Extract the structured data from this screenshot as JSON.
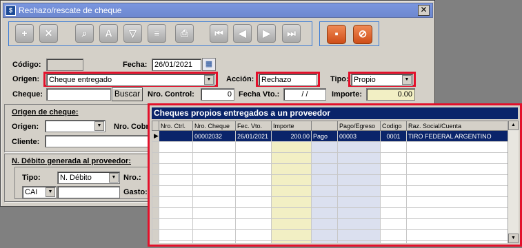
{
  "window": {
    "title": "Rechazo/rescate de cheque",
    "close_label": "✕"
  },
  "toolbar": {
    "buttons": [
      {
        "name": "add",
        "glyph": "+"
      },
      {
        "name": "delete",
        "glyph": "✕"
      },
      {
        "name": "search",
        "glyph": "⌕"
      },
      {
        "name": "sort",
        "glyph": "A"
      },
      {
        "name": "filter",
        "glyph": "▽"
      },
      {
        "name": "document",
        "glyph": "≡"
      },
      {
        "name": "print",
        "glyph": "⎙"
      },
      {
        "name": "first",
        "glyph": "⏮"
      },
      {
        "name": "prev",
        "glyph": "◀"
      },
      {
        "name": "next",
        "glyph": "▶"
      },
      {
        "name": "last",
        "glyph": "⏭"
      }
    ],
    "save_glyph": "▪",
    "cancel_glyph": "⊘"
  },
  "form": {
    "codigo_label": "Código:",
    "codigo_value": "",
    "fecha_label": "Fecha:",
    "fecha_value": "26/01/2021",
    "origen_label": "Origen:",
    "origen_value": "Cheque entregado",
    "accion_label": "Acción:",
    "accion_value": "Rechazo",
    "tipo_label": "Tipo:",
    "tipo_value": "Propio",
    "cheque_label": "Cheque:",
    "cheque_value": "",
    "buscar_label": "Buscar",
    "nro_control_label": "Nro. Control:",
    "nro_control_value": "0",
    "fecha_vto_label": "Fecha Vto.:",
    "fecha_vto_value": " / /",
    "importe_label": "Importe:",
    "importe_value": "0.00"
  },
  "origen_cheque": {
    "section_label": "Origen de cheque:",
    "origen_label": "Origen:",
    "origen_value": "",
    "nro_cobr_label": "Nro. Cobr",
    "cliente_label": "Cliente:",
    "cliente_value": ""
  },
  "debito": {
    "section_label": "N. Débito generada al proveedor:",
    "tipo_label": "Tipo:",
    "tipo_value": "N. Débito",
    "nro_label": "Nro.:",
    "cai_value": "CAI",
    "gasto_label": "Gasto:"
  },
  "grid": {
    "title": "Cheques propios entregados a un proveedor",
    "columns": [
      "",
      "Nro. Ctrl.",
      "Nro. Cheque",
      "Fec. Vto.",
      "Importe",
      "",
      "Pago/Egreso",
      "Codigo",
      "Raz. Social/Cuenta"
    ],
    "rows": [
      {
        "marker": "▶",
        "ctrl": "",
        "cheque": "00002032",
        "vto": "26/01/2021",
        "importe": "200.00",
        "tipo": "Pago",
        "egreso": "00003",
        "codigo": "0001",
        "razon": "TIRO FEDERAL ARGENTINO"
      }
    ],
    "empty_rows": 10
  }
}
